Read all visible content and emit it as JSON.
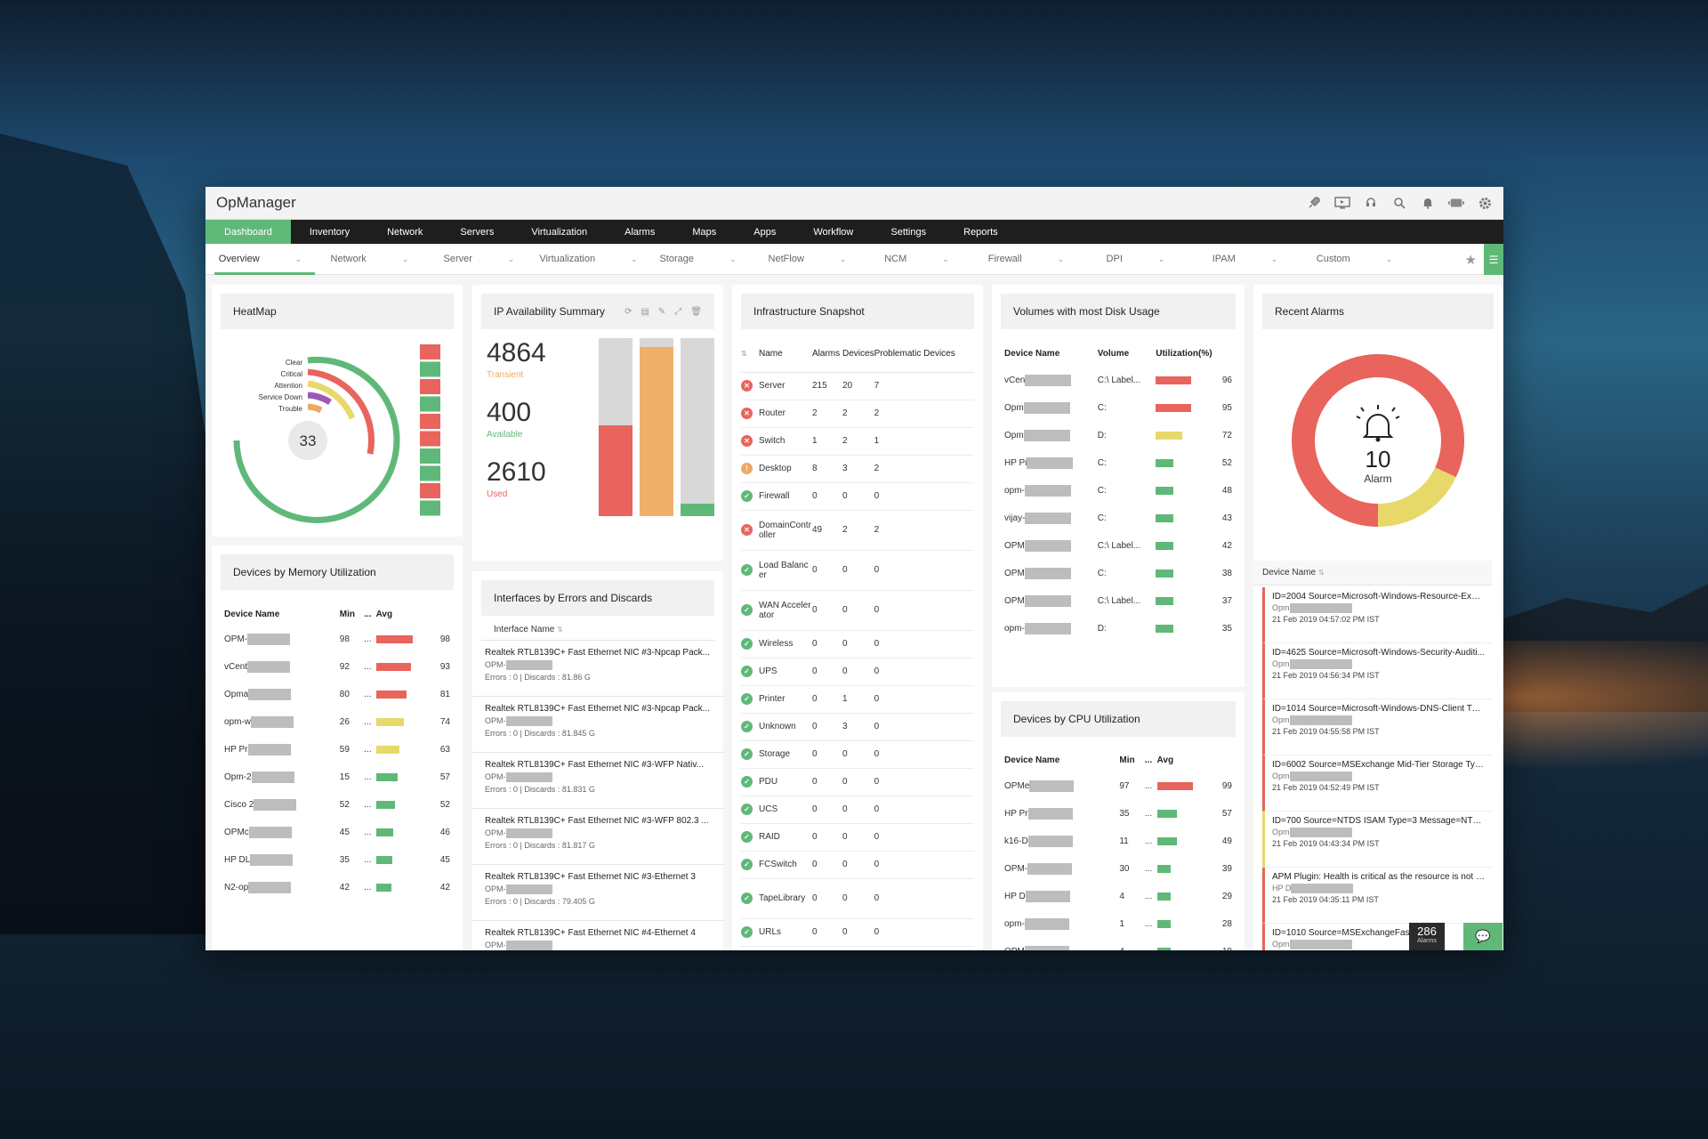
{
  "app_title": "OpManager",
  "topnav": [
    "Dashboard",
    "Inventory",
    "Network",
    "Servers",
    "Virtualization",
    "Alarms",
    "Maps",
    "Apps",
    "Workflow",
    "Settings",
    "Reports"
  ],
  "subnav": [
    "Overview",
    "Network",
    "Server",
    "Virtualization",
    "Storage",
    "NetFlow",
    "NCM",
    "Firewall",
    "DPI",
    "IPAM",
    "Custom"
  ],
  "colors": {
    "green": "#5fb878",
    "red": "#e8645c",
    "yellow": "#e8d86a",
    "orange": "#f0a860",
    "purple": "#9b59b6",
    "gray": "#d8d8d8"
  },
  "heatmap": {
    "title": "HeatMap",
    "legend": [
      "Clear",
      "Critical",
      "Attention",
      "Service Down",
      "Trouble"
    ],
    "total": "33",
    "cells": [
      "red",
      "green",
      "red",
      "green",
      "red",
      "red",
      "green",
      "green",
      "red",
      "green"
    ]
  },
  "ip_summary": {
    "title": "IP Availability Summary",
    "transient_value": "4864",
    "transient_label": "Transient",
    "available_value": "400",
    "available_label": "Available",
    "used_value": "2610",
    "used_label": "Used",
    "bars": [
      {
        "name": "transient",
        "fill_fraction": 0.51,
        "color": "#e8645c"
      },
      {
        "name": "available",
        "fill_fraction": 0.95,
        "color": "#f0b06a"
      },
      {
        "name": "used",
        "fill_fraction": 0.07,
        "color": "#5fb878"
      }
    ]
  },
  "infra": {
    "title": "Infrastructure Snapshot",
    "headers": [
      "Name",
      "Alarms",
      "Devices",
      "Problematic Devices"
    ],
    "rows": [
      {
        "status": "critical",
        "name": "Server",
        "alarms": "215",
        "devices": "20",
        "problematic": "7"
      },
      {
        "status": "critical",
        "name": "Router",
        "alarms": "2",
        "devices": "2",
        "problematic": "2"
      },
      {
        "status": "critical",
        "name": "Switch",
        "alarms": "1",
        "devices": "2",
        "problematic": "1"
      },
      {
        "status": "warning",
        "name": "Desktop",
        "alarms": "8",
        "devices": "3",
        "problematic": "2"
      },
      {
        "status": "ok",
        "name": "Firewall",
        "alarms": "0",
        "devices": "0",
        "problematic": "0"
      },
      {
        "status": "critical",
        "name": "DomainController",
        "alarms": "49",
        "devices": "2",
        "problematic": "2"
      },
      {
        "status": "ok",
        "name": "Load Balancer",
        "alarms": "0",
        "devices": "0",
        "problematic": "0"
      },
      {
        "status": "ok",
        "name": "WAN Accelerator",
        "alarms": "0",
        "devices": "0",
        "problematic": "0"
      },
      {
        "status": "ok",
        "name": "Wireless",
        "alarms": "0",
        "devices": "0",
        "problematic": "0"
      },
      {
        "status": "ok",
        "name": "UPS",
        "alarms": "0",
        "devices": "0",
        "problematic": "0"
      },
      {
        "status": "ok",
        "name": "Printer",
        "alarms": "0",
        "devices": "1",
        "problematic": "0"
      },
      {
        "status": "ok",
        "name": "Unknown",
        "alarms": "0",
        "devices": "3",
        "problematic": "0"
      },
      {
        "status": "ok",
        "name": "Storage",
        "alarms": "0",
        "devices": "0",
        "problematic": "0"
      },
      {
        "status": "ok",
        "name": "PDU",
        "alarms": "0",
        "devices": "0",
        "problematic": "0"
      },
      {
        "status": "ok",
        "name": "UCS",
        "alarms": "0",
        "devices": "0",
        "problematic": "0"
      },
      {
        "status": "ok",
        "name": "RAID",
        "alarms": "0",
        "devices": "0",
        "problematic": "0"
      },
      {
        "status": "ok",
        "name": "FCSwitch",
        "alarms": "0",
        "devices": "0",
        "problematic": "0"
      },
      {
        "status": "ok",
        "name": "TapeLibrary",
        "alarms": "0",
        "devices": "0",
        "problematic": "0"
      },
      {
        "status": "ok",
        "name": "URLs",
        "alarms": "0",
        "devices": "0",
        "problematic": "0"
      }
    ]
  },
  "volumes": {
    "title": "Volumes with most Disk Usage",
    "headers": [
      "Device Name",
      "Volume",
      "Utilization(%)"
    ],
    "rows": [
      {
        "device": "vCen",
        "volume": "C:\\ Label...",
        "util": 96
      },
      {
        "device": "Opm",
        "volume": "C:",
        "util": 95
      },
      {
        "device": "Opm",
        "volume": "D:",
        "util": 72
      },
      {
        "device": "HP Pi",
        "volume": "C:",
        "util": 52
      },
      {
        "device": "opm-",
        "volume": "C:",
        "util": 48
      },
      {
        "device": "vijay-",
        "volume": "C:",
        "util": 43
      },
      {
        "device": "OPM",
        "volume": "C:\\ Label...",
        "util": 42
      },
      {
        "device": "OPM",
        "volume": "C:",
        "util": 38
      },
      {
        "device": "OPM",
        "volume": "C:\\ Label...",
        "util": 37
      },
      {
        "device": "opm-",
        "volume": "D:",
        "util": 35
      }
    ]
  },
  "memory": {
    "title": "Devices by Memory Utilization",
    "headers": [
      "Device Name",
      "Min",
      "...",
      "Avg"
    ],
    "rows": [
      {
        "device": "OPM-",
        "min": "98",
        "avg": 98
      },
      {
        "device": "vCent",
        "min": "92",
        "avg": 93
      },
      {
        "device": "Opma",
        "min": "80",
        "avg": 81
      },
      {
        "device": "opm-w",
        "min": "26",
        "avg": 74
      },
      {
        "device": "HP Pr",
        "min": "59",
        "avg": 63
      },
      {
        "device": "Opm-2",
        "min": "15",
        "avg": 57
      },
      {
        "device": "Cisco 2",
        "min": "52",
        "avg": 52
      },
      {
        "device": "OPMc",
        "min": "45",
        "avg": 46
      },
      {
        "device": "HP DL",
        "min": "35",
        "avg": 45
      },
      {
        "device": "N2-op",
        "min": "42",
        "avg": 42
      }
    ]
  },
  "interfaces": {
    "title": "Interfaces by Errors and Discards",
    "column": "Interface Name",
    "rows": [
      {
        "name": "Realtek RTL8139C+ Fast Ethernet NIC #3-Npcap Pack...",
        "device": "OPM-",
        "stats": "Errors : 0 | Discards : 81.86 G"
      },
      {
        "name": "Realtek RTL8139C+ Fast Ethernet NIC #3-Npcap Pack...",
        "device": "OPM-",
        "stats": "Errors : 0 | Discards : 81.845 G"
      },
      {
        "name": "Realtek RTL8139C+ Fast Ethernet NIC #3-WFP Nativ...",
        "device": "OPM-",
        "stats": "Errors : 0 | Discards : 81.831 G"
      },
      {
        "name": "Realtek RTL8139C+ Fast Ethernet NIC #3-WFP 802.3 ...",
        "device": "OPM-",
        "stats": "Errors : 0 | Discards : 81.817 G"
      },
      {
        "name": "Realtek RTL8139C+ Fast Ethernet NIC #3-Ethernet 3",
        "device": "OPM-",
        "stats": "Errors : 0 | Discards : 79.405 G"
      },
      {
        "name": "Realtek RTL8139C+ Fast Ethernet NIC #4-Ethernet 4",
        "device": "OPM-",
        "stats": ""
      }
    ]
  },
  "cpu": {
    "title": "Devices by CPU Utilization",
    "headers": [
      "Device Name",
      "Min",
      "...",
      "Avg"
    ],
    "rows": [
      {
        "device": "OPMe",
        "min": "97",
        "avg": 99
      },
      {
        "device": "HP Pr",
        "min": "35",
        "avg": 57
      },
      {
        "device": "k16-D",
        "min": "11",
        "avg": 49
      },
      {
        "device": "OPM-",
        "min": "30",
        "avg": 39
      },
      {
        "device": "HP D",
        "min": "4",
        "avg": 29
      },
      {
        "device": "opm-",
        "min": "1",
        "avg": 28
      },
      {
        "device": "OPM",
        "min": "4",
        "avg": 19
      }
    ]
  },
  "alarms": {
    "title": "Recent Alarms",
    "count": "10",
    "count_label": "Alarm",
    "critical_fraction": 0.82,
    "trouble_fraction": 0.18,
    "column": "Device Name",
    "items": [
      {
        "title": "ID=2004 Source=Microsoft-Windows-Resource-Exha...",
        "device": "Opm",
        "time": "21 Feb 2019 04:57:02 PM IST",
        "severity": "critical"
      },
      {
        "title": "ID=4625 Source=Microsoft-Windows-Security-Auditi...",
        "device": "Opm",
        "time": "21 Feb 2019 04:56:34 PM IST",
        "severity": "critical"
      },
      {
        "title": "ID=1014 Source=Microsoft-Windows-DNS-Client Typ...",
        "device": "Opm",
        "time": "21 Feb 2019 04:55:58 PM IST",
        "severity": "critical"
      },
      {
        "title": "ID=6002 Source=MSExchange Mid-Tier Storage Type=...",
        "device": "Opm",
        "time": "21 Feb 2019 04:52:49 PM IST",
        "severity": "critical"
      },
      {
        "title": "ID=700 Source=NTDS ISAM Type=3 Message=NTDS (...",
        "device": "Opm",
        "time": "21 Feb 2019 04:43:34 PM IST",
        "severity": "trouble"
      },
      {
        "title": "APM Plugin: Health is critical as the resource is not ava...",
        "device": "HP D",
        "time": "21 Feb 2019 04:35:11 PM IST",
        "severity": "critical"
      },
      {
        "title": "ID=1010 Source=MSExchangeFast...pe=...",
        "device": "Opm",
        "time": "",
        "severity": "critical"
      }
    ],
    "badge_count": "286",
    "badge_label": "Alarms"
  }
}
